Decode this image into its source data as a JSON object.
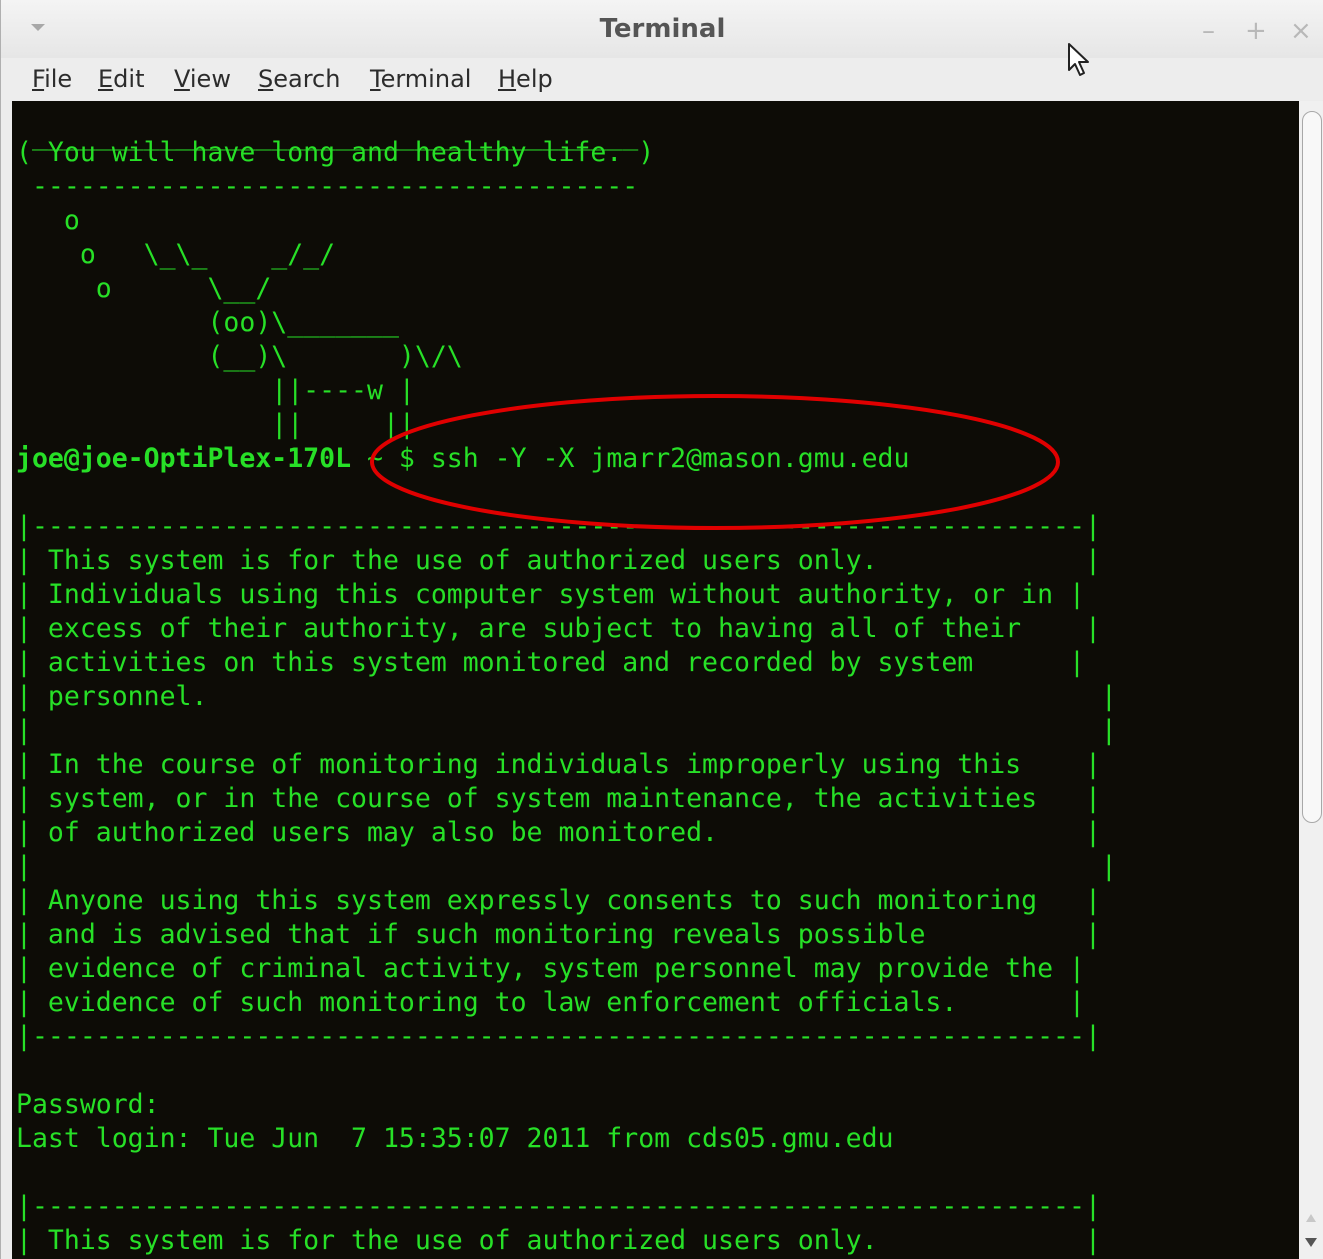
{
  "window": {
    "title": "Terminal",
    "controls": {
      "minimize": "–",
      "maximize": "+",
      "close": "×"
    }
  },
  "menubar": [
    {
      "mnemonic": "F",
      "rest": "ile"
    },
    {
      "mnemonic": "E",
      "rest": "dit"
    },
    {
      "mnemonic": "V",
      "rest": "iew"
    },
    {
      "mnemonic": "S",
      "rest": "earch"
    },
    {
      "mnemonic": "T",
      "rest": "erminal"
    },
    {
      "mnemonic": "H",
      "rest": "elp"
    }
  ],
  "terminal": {
    "prompt_user": "joe@joe-OptiPlex-170L",
    "prompt_dir": " ~ $ ",
    "command": "ssh -Y -X jmarr2@mason.gmu.edu",
    "lines_before_prompt": [
      " ______________________________________",
      "( You will have long and healthy life. )",
      " --------------------------------------",
      "   o",
      "    o   \\_\\_    _/_/",
      "     o      \\__/",
      "            (oo)\\_______",
      "            (__)\\       )\\/\\",
      "                ||----w |",
      "                ||     ||"
    ],
    "lines_after_prompt": [
      "",
      "|------------------------------------------------------------------|",
      "| This system is for the use of authorized users only.             |",
      "| Individuals using this computer system without authority, or in |",
      "| excess of their authority, are subject to having all of their    |",
      "| activities on this system monitored and recorded by system      |",
      "| personnel.                                                        |",
      "|                                                                   |",
      "| In the course of monitoring individuals improperly using this    |",
      "| system, or in the course of system maintenance, the activities   |",
      "| of authorized users may also be monitored.                       |",
      "|                                                                   |",
      "| Anyone using this system expressly consents to such monitoring   |",
      "| and is advised that if such monitoring reveals possible          |",
      "| evidence of criminal activity, system personnel may provide the |",
      "| evidence of such monitoring to law enforcement officials.       |",
      "|------------------------------------------------------------------|",
      "",
      "Password:",
      "Last login: Tue Jun  7 15:35:07 2011 from cds05.gmu.edu",
      "",
      "|------------------------------------------------------------------|",
      "| This system is for the use of authorized users only.             |"
    ]
  },
  "colors": {
    "terminal_background": "#0d0c06",
    "terminal_text": "#27e027",
    "annotation_ellipse": "#e00000"
  }
}
